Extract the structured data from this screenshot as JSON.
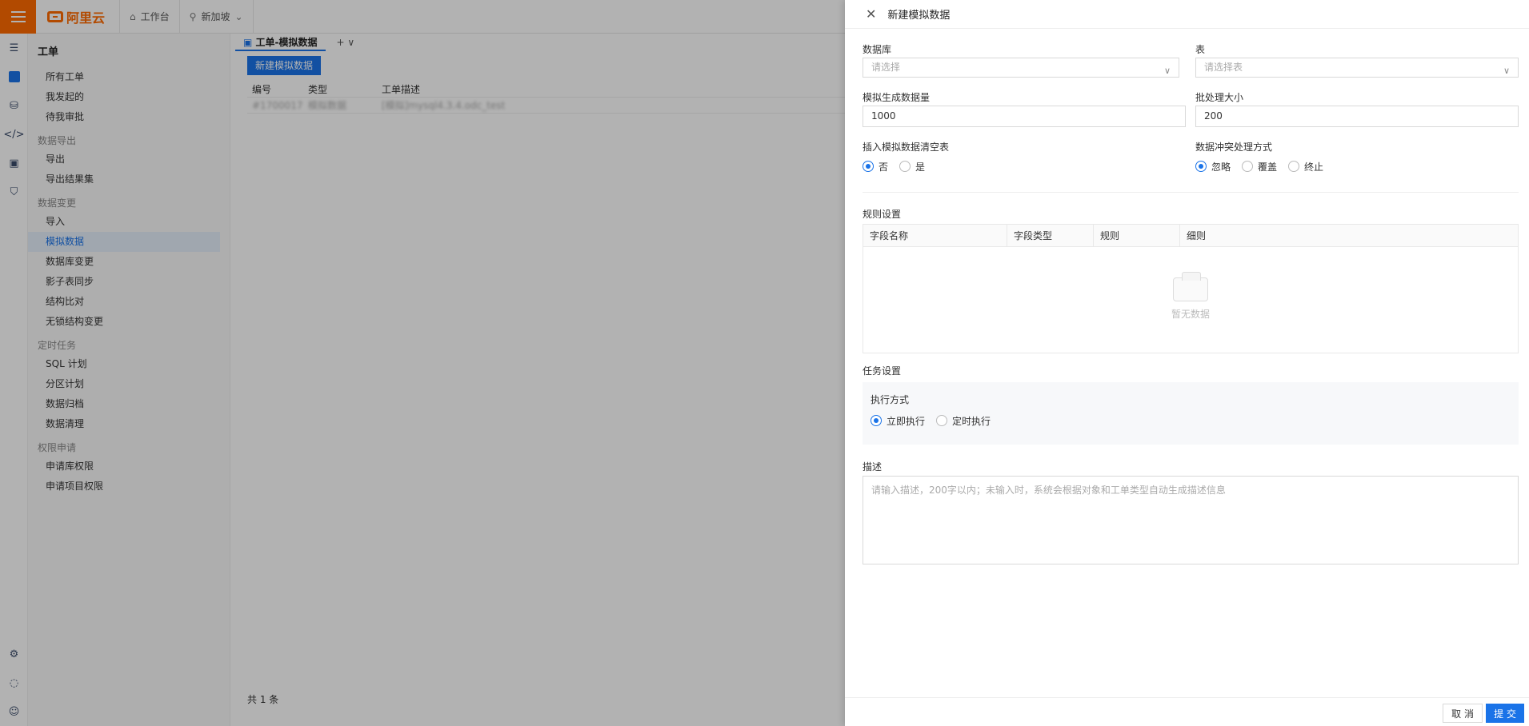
{
  "topbar": {
    "brand": "阿里云",
    "workbench": "工作台",
    "region": "新加坡"
  },
  "sidebar": {
    "title": "工单",
    "groups": [
      {
        "label": "",
        "items": [
          "所有工单",
          "我发起的",
          "待我审批"
        ]
      },
      {
        "label": "数据导出",
        "items": [
          "导出",
          "导出结果集"
        ]
      },
      {
        "label": "数据变更",
        "items": [
          "导入",
          "模拟数据",
          "数据库变更",
          "影子表同步",
          "结构比对",
          "无锁结构变更"
        ]
      },
      {
        "label": "定时任务",
        "items": [
          "SQL 计划",
          "分区计划",
          "数据归档",
          "数据清理"
        ]
      },
      {
        "label": "权限申请",
        "items": [
          "申请库权限",
          "申请项目权限"
        ]
      }
    ],
    "active_item": "模拟数据"
  },
  "main": {
    "tab_label": "工单-模拟数据",
    "tab_add": "+ ∨",
    "new_button": "新建模拟数据",
    "columns": [
      "编号",
      "类型",
      "工单描述"
    ],
    "rows": [
      {
        "id": "#1700017",
        "type": "模拟数据",
        "desc": "[模拟]mysql4.3.4.odc_test"
      }
    ],
    "total": "共 1 条"
  },
  "drawer": {
    "title": "新建模拟数据",
    "database": {
      "label": "数据库",
      "placeholder": "请选择"
    },
    "table": {
      "label": "表",
      "placeholder": "请选择表"
    },
    "count": {
      "label": "模拟生成数据量",
      "value": "1000"
    },
    "batch": {
      "label": "批处理大小",
      "value": "200"
    },
    "clear_table": {
      "label": "插入模拟数据清空表",
      "options": [
        "否",
        "是"
      ],
      "selected": 0
    },
    "conflict": {
      "label": "数据冲突处理方式",
      "options": [
        "忽略",
        "覆盖",
        "终止"
      ],
      "selected": 0
    },
    "rules": {
      "label": "规则设置",
      "columns": [
        "字段名称",
        "字段类型",
        "规则",
        "细则"
      ],
      "empty": "暂无数据"
    },
    "task": {
      "label": "任务设置",
      "exec_label": "执行方式",
      "options": [
        "立即执行",
        "定时执行"
      ],
      "selected": 0
    },
    "description": {
      "label": "描述",
      "placeholder": "请输入描述，200字以内；未输入时，系统会根据对象和工单类型自动生成描述信息"
    },
    "cancel": "取 消",
    "submit": "提 交"
  }
}
